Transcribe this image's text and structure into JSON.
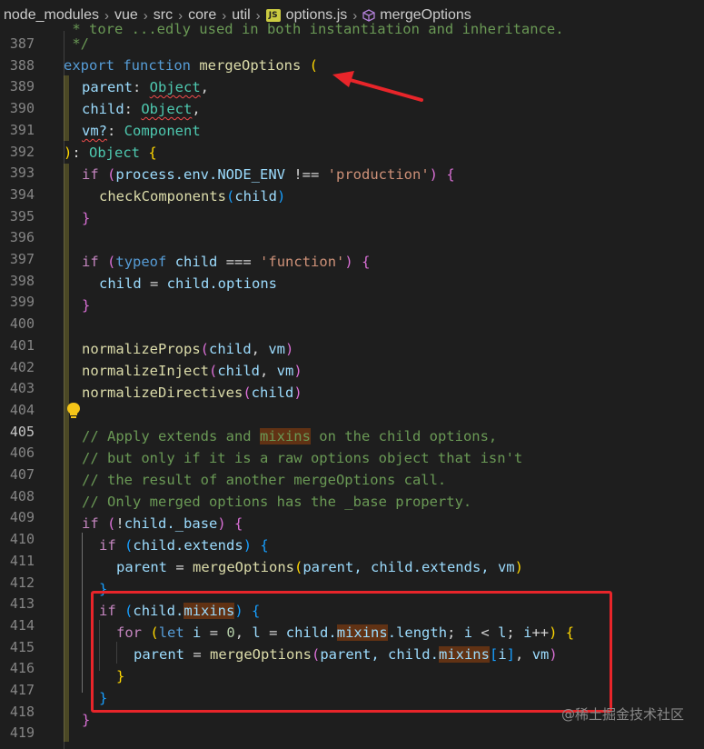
{
  "breadcrumb": {
    "items": [
      "node_modules",
      "vue",
      "src",
      "core",
      "util"
    ],
    "file": "options.js",
    "symbol": "mergeOptions",
    "file_icon_label": "JS"
  },
  "editor": {
    "line_numbers": [
      "387",
      "388",
      "389",
      "390",
      "391",
      "392",
      "393",
      "394",
      "395",
      "396",
      "397",
      "398",
      "399",
      "400",
      "401",
      "402",
      "403",
      "404",
      "405",
      "406",
      "407",
      "408",
      "409",
      "410",
      "411",
      "412",
      "413",
      "414",
      "415",
      "416",
      "417",
      "418",
      "419"
    ],
    "active_line": "405",
    "partial_top_text": " * tore ...edly used in both instantiation and inheritance.",
    "lines": {
      "l387": " */",
      "l389_param": "parent",
      "l389_type": "Object",
      "l390_param": "child",
      "l390_type": "Object",
      "l391_param": "vm?",
      "l391_type": "Component",
      "l392_type": "Object",
      "l393_env": "process.env.NODE_ENV",
      "l393_str": "'production'",
      "l394_fn": "checkComponents",
      "l394_arg": "child",
      "l397_str": "'function'",
      "l398_a": "child",
      "l398_b": "child.options",
      "l401_fn": "normalizeProps",
      "l402_fn": "normalizeInject",
      "l403_fn": "normalizeDirectives",
      "l405_a": "// Apply extends and ",
      "l405_hl": "mixins",
      "l405_b": " on the child options,",
      "l406": "// but only if it is a raw options object that isn't",
      "l407": "// the result of another mergeOptions call.",
      "l408": "// Only merged options has the _base property.",
      "l409_prop": "child._base",
      "l410_prop": "child.extends",
      "l411_fn": "mergeOptions",
      "l411_args": "parent, child.extends, vm",
      "l413_obj": "child.",
      "l413_hl": "mixins",
      "l414_let": "let",
      "l414_i": "i",
      "l414_zero": "0",
      "l414_l": "l",
      "l414_obj": "child.",
      "l414_hl": "mixins",
      "l414_len": ".length",
      "l415_fn": "mergeOptions",
      "l415_a": "parent, child.",
      "l415_hl": "mixins",
      "l415_idx": "i",
      "l415_vm": "vm"
    },
    "keywords": {
      "export": "export",
      "function": "function",
      "fn_name": "mergeOptions",
      "if": "if",
      "for": "for",
      "typeof": "typeof"
    }
  },
  "watermark": "@稀土掘金技术社区",
  "colors": {
    "annotation_red": "#e8252a",
    "background": "#1e1e1e",
    "highlight": "#613214"
  }
}
